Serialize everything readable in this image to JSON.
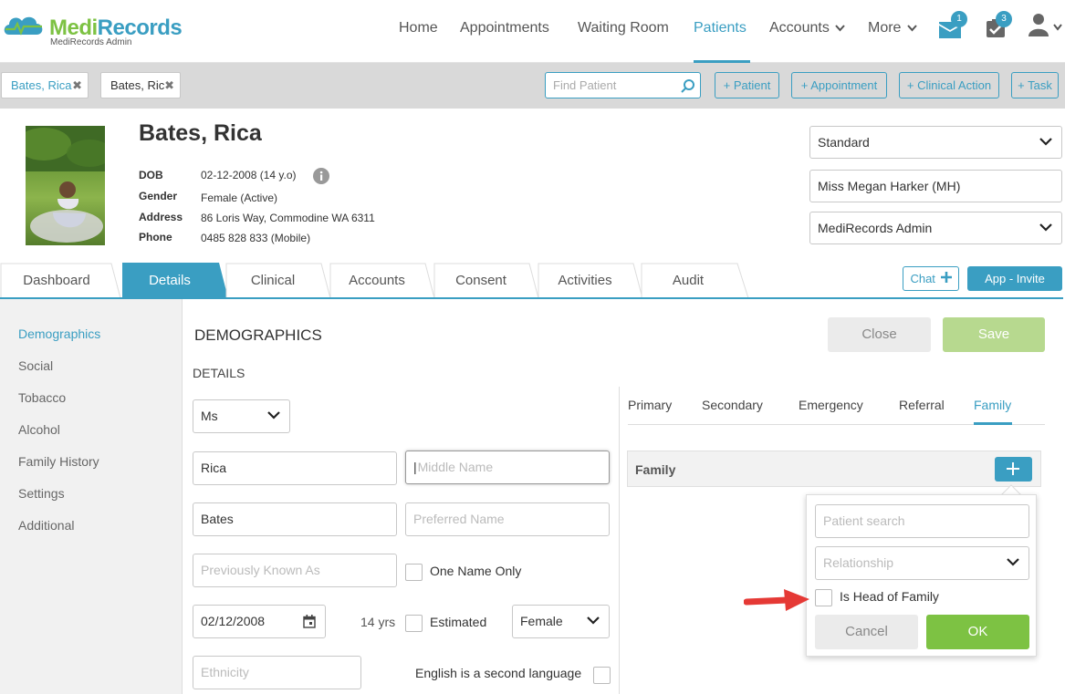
{
  "brand": {
    "name": "MediRecords",
    "sub": "MediRecords Admin"
  },
  "nav": {
    "home": "Home",
    "appointments": "Appointments",
    "waiting_room": "Waiting Room",
    "patients": "Patients",
    "accounts": "Accounts",
    "more": "More",
    "mail_badge": "1",
    "tasks_badge": "3"
  },
  "toolbar": {
    "tabs": [
      "Bates, Rica",
      "Bates, Ric"
    ],
    "search_placeholder": "Find Patient",
    "buttons": [
      "+ Patient",
      "+ Appointment",
      "+ Clinical Action",
      "+ Task"
    ]
  },
  "patient": {
    "name": "Bates, Rica",
    "dob_label": "DOB",
    "dob": "02-12-2008 (14 y.o)",
    "gender_label": "Gender",
    "gender": "Female (Active)",
    "address_label": "Address",
    "address": "86 Loris Way, Commodine WA 6311",
    "phone_label": "Phone",
    "phone": "0485 828 833 (Mobile)"
  },
  "header_selects": {
    "billing": "Standard",
    "practitioner": "Miss Megan Harker (MH)",
    "location": "MediRecords Admin"
  },
  "tabs": [
    "Dashboard",
    "Details",
    "Clinical",
    "Accounts",
    "Consent",
    "Activities",
    "Audit"
  ],
  "chat_label": "Chat",
  "app_invite_label": "App - Invite",
  "sidebar": [
    "Demographics",
    "Social",
    "Tobacco",
    "Alcohol",
    "Family History",
    "Settings",
    "Additional"
  ],
  "section": {
    "title": "DEMOGRAPHICS",
    "close": "Close",
    "save": "Save",
    "details": "DETAILS"
  },
  "form": {
    "title_value": "Ms",
    "first_name": "Rica",
    "middle_placeholder": "Middle Name",
    "last_name": "Bates",
    "preferred_placeholder": "Preferred Name",
    "prev_known_placeholder": "Previously Known As",
    "one_name_only": "One Name Only",
    "dob": "02/12/2008",
    "age": "14 yrs",
    "estimated": "Estimated",
    "gender": "Female",
    "ethnicity_placeholder": "Ethnicity",
    "esl": "English is a second language"
  },
  "contact_tabs": [
    "Primary",
    "Secondary",
    "Emergency",
    "Referral",
    "Family"
  ],
  "family": {
    "header": "Family",
    "patient_search_placeholder": "Patient search",
    "relationship_placeholder": "Relationship",
    "head_of_family": "Is Head of Family",
    "cancel": "Cancel",
    "ok": "OK"
  },
  "colors": {
    "accent": "#3a9ec2",
    "ok": "#7dc243",
    "save_disabled": "#b7d98f",
    "annotation": "#e53935"
  },
  "icons": [
    "mail-icon",
    "tasks-icon",
    "user-icon",
    "search-icon",
    "info-icon",
    "calendar-icon",
    "plus-icon",
    "chevron-down-icon",
    "close-icon",
    "arrow-annotation"
  ]
}
